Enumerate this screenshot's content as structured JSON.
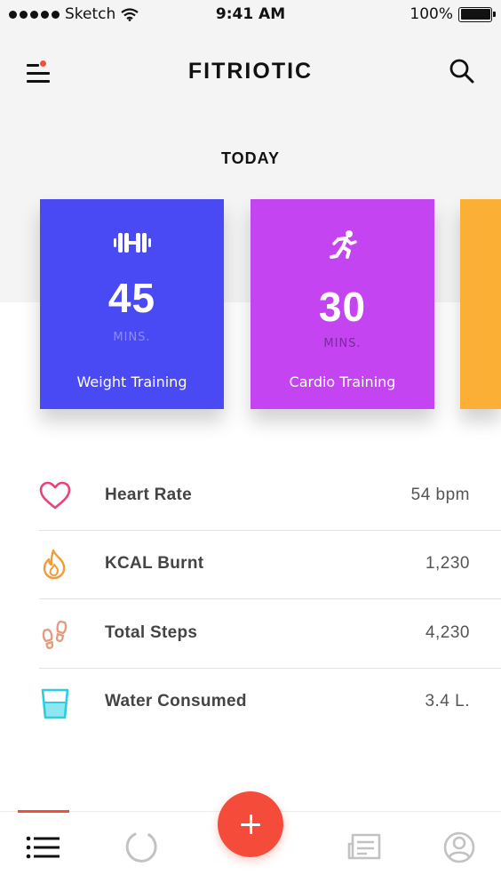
{
  "status_bar": {
    "carrier": "Sketch",
    "time": "9:41 AM",
    "battery": "100%"
  },
  "header": {
    "title": "FITRIOTIC",
    "menu_icon": "hamburger-menu-icon",
    "search_icon": "search-icon"
  },
  "section": {
    "title": "TODAY"
  },
  "cards": [
    {
      "icon": "dumbbell-icon",
      "value": "45",
      "unit": "MINS.",
      "label": "Weight Training",
      "color": "#4a4af5"
    },
    {
      "icon": "running-icon",
      "value": "30",
      "unit": "MINS.",
      "label": "Cardio Training",
      "color": "#c344f0"
    },
    {
      "icon": "",
      "value": "",
      "unit": "",
      "label": "",
      "color": "#fbb035"
    }
  ],
  "metrics": [
    {
      "icon": "heart-icon",
      "label": "Heart Rate",
      "value": "54 bpm",
      "color": "#e8437a"
    },
    {
      "icon": "flame-icon",
      "label": "KCAL Burnt",
      "value": "1,230",
      "color": "#f39a3a"
    },
    {
      "icon": "footprints-icon",
      "label": "Total Steps",
      "value": "4,230",
      "color": "#e39b7c"
    },
    {
      "icon": "water-glass-icon",
      "label": "Water Consumed",
      "value": "3.4 L.",
      "color": "#29cfe0"
    }
  ],
  "tabbar": {
    "active_color": "#f0503a",
    "fab_color": "#f44b3a",
    "tabs": [
      "list-icon",
      "progress-icon",
      "add-icon",
      "journal-icon",
      "profile-icon"
    ]
  }
}
